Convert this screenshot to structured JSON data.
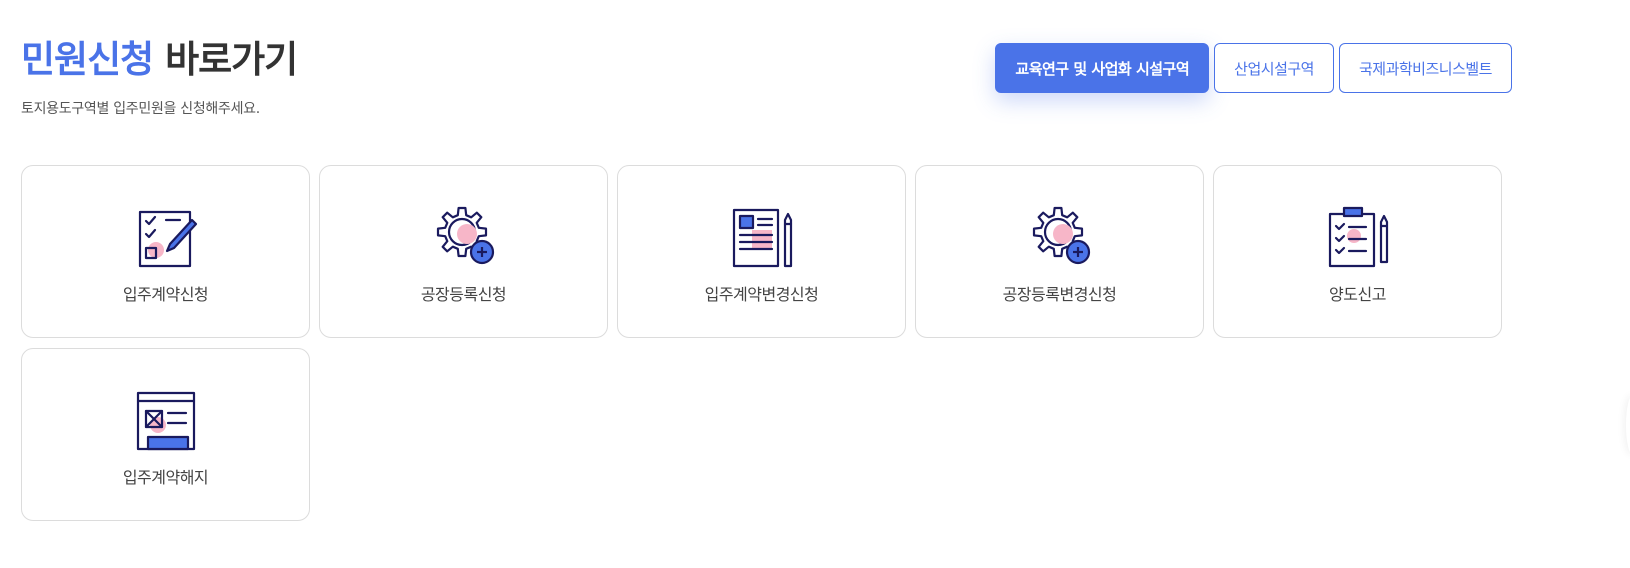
{
  "header": {
    "title_accent": "민원신청",
    "title_rest": "바로가기",
    "subtitle": "토지용도구역별 입주민원을 신청해주세요."
  },
  "tabs": [
    {
      "label": "교육연구 및 사업화 시설구역",
      "active": true
    },
    {
      "label": "산업시설구역",
      "active": false
    },
    {
      "label": "국제과학비즈니스벨트",
      "active": false
    }
  ],
  "cards": [
    {
      "label": "입주계약신청",
      "icon": "checklist-pencil-icon"
    },
    {
      "label": "공장등록신청",
      "icon": "gear-plus-icon"
    },
    {
      "label": "입주계약변경신청",
      "icon": "document-pencil-icon"
    },
    {
      "label": "공장등록변경신청",
      "icon": "gear-plus-icon"
    },
    {
      "label": "양도신고",
      "icon": "clipboard-pencil-icon"
    },
    {
      "label": "입주계약해지",
      "icon": "cancel-form-icon"
    }
  ],
  "colors": {
    "accent": "#4a73e8",
    "icon_stroke": "#1a1a5e",
    "icon_highlight": "#f7b6c8"
  }
}
